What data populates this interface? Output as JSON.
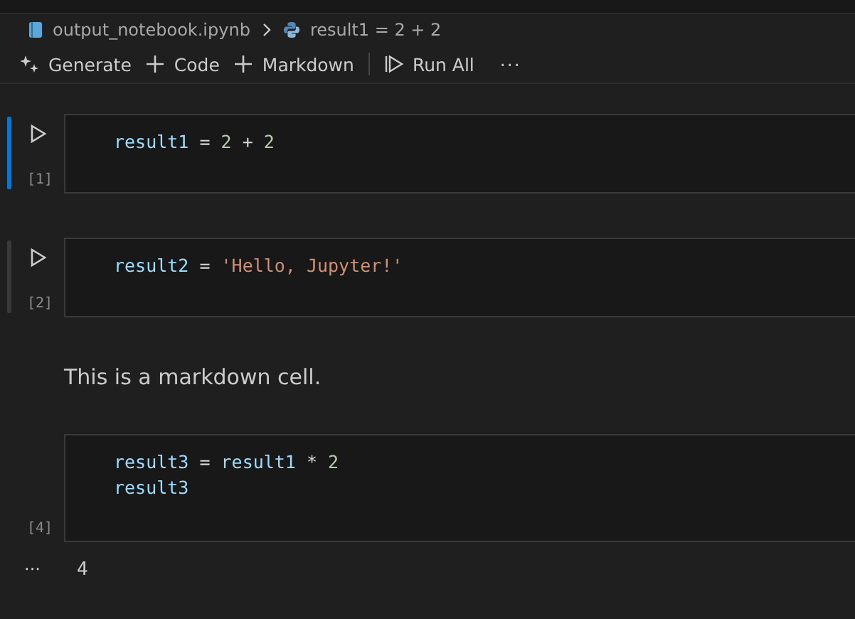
{
  "breadcrumb": [
    {
      "kind": "notebook",
      "label": "output_notebook.ipynb"
    },
    {
      "kind": "python",
      "label": "result1 = 2 + 2"
    }
  ],
  "toolbar": [
    {
      "kind": "sparkle",
      "label": "Generate"
    },
    {
      "kind": "plus",
      "label": "Code"
    },
    {
      "kind": "plus",
      "label": "Markdown"
    },
    {
      "kind": "divider"
    },
    {
      "kind": "run",
      "label": "Run All"
    },
    {
      "kind": "more",
      "label": "···"
    }
  ],
  "cells": [
    {
      "kind": "code",
      "selected": true,
      "hovered": false,
      "count": "[1]",
      "lines": [
        [
          {
            "kind": "var",
            "text": "result1"
          },
          {
            "kind": "op",
            "text": " = "
          },
          {
            "kind": "num",
            "text": "2"
          },
          {
            "kind": "op",
            "text": " + "
          },
          {
            "kind": "num",
            "text": "2"
          }
        ]
      ]
    },
    {
      "kind": "code",
      "selected": false,
      "hovered": true,
      "count": "[2]",
      "lines": [
        [
          {
            "kind": "var",
            "text": "result2"
          },
          {
            "kind": "op",
            "text": " = "
          },
          {
            "kind": "str",
            "text": "'Hello, Jupyter!'"
          }
        ]
      ]
    },
    {
      "kind": "markdown",
      "selected": false,
      "hovered": false,
      "text": "This is a markdown cell."
    },
    {
      "kind": "code",
      "selected": false,
      "hovered": false,
      "count": "[4]",
      "lines": [
        [
          {
            "kind": "var",
            "text": "result3"
          },
          {
            "kind": "op",
            "text": " = "
          },
          {
            "kind": "var",
            "text": "result1"
          },
          {
            "kind": "op",
            "text": " * "
          },
          {
            "kind": "num",
            "text": "2"
          }
        ],
        [
          {
            "kind": "var",
            "text": "result3"
          }
        ]
      ],
      "output": {
        "marker": "···",
        "text": "4"
      }
    }
  ]
}
